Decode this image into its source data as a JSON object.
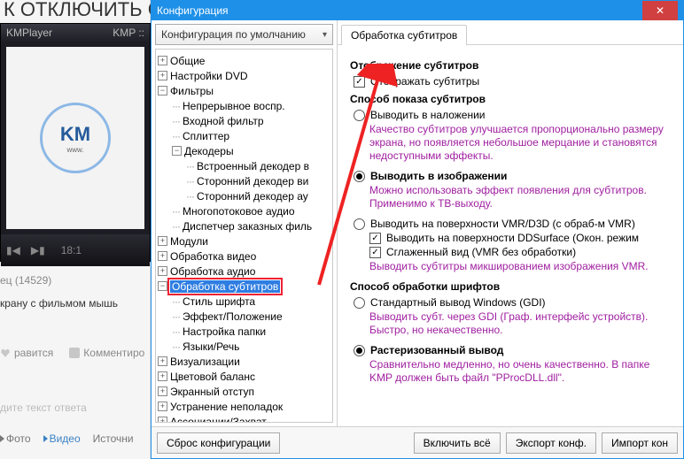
{
  "bg": {
    "title": "К ОТКЛЮЧИТЬ СУ",
    "kmp_title_left": "KMPlayer",
    "kmp_title_right": "KMP ::",
    "kmp_logo_text": "KM",
    "kmp_logo_sub": "www.",
    "kmp_time": "18:1",
    "meta": "ец (14529)",
    "instr": "крану с фильмом мышь",
    "like": "равится",
    "comment": "Комментиро",
    "answer_ph": "дите текст ответа",
    "tab_photo": "Фото",
    "tab_video": "Видео",
    "tab_src": "Источни"
  },
  "cfg": {
    "title": "Конфигурация",
    "combo": "Конфигурация по умолчанию",
    "tree": {
      "general": "Общие",
      "dvd": "Настройки DVD",
      "filters": "Фильтры",
      "f_cont": "Непрерывное воспр.",
      "f_in": "Входной фильтр",
      "f_split": "Сплиттер",
      "decoders": "Декодеры",
      "d_builtin": "Встроенный декодер в",
      "d_extv": "Сторонний декодер ви",
      "d_exta": "Сторонний декодер ау",
      "multi": "Многопотоковое аудио",
      "disp": "Диспетчер заказных филь",
      "modules": "Модули",
      "vproc": "Обработка видео",
      "aproc": "Обработка аудио",
      "sproc": "Обработка субтитров",
      "s_font": "Стиль шрифта",
      "s_eff": "Эффект/Положение",
      "s_folder": "Настройка папки",
      "s_lang": "Языки/Речь",
      "vis": "Визуализации",
      "color": "Цветовой баланс",
      "pan": "Экранный отступ",
      "trouble": "Устранение неполадок",
      "assoc": "Ассоциации/Захват"
    },
    "tab": "Обработка субтитров",
    "grp_display": "Отображение субтитров",
    "chk_show": "Отображать субтитры",
    "grp_method": "Способ показа субтитров",
    "r_overlay": "Выводить в наложении",
    "r_overlay_desc": "Качество субтитров улучшается пропорционально размеру экрана, но появляется небольшое мерцание и становятся недоступными эффекты.",
    "r_image": "Выводить в изображении",
    "r_image_desc": "Можно использовать эффект появления для субтитров. Применимо к ТВ-выходу.",
    "r_vmr": "Выводить на поверхности VMR/D3D (с обраб-м VMR)",
    "c_dd": "Выводить на поверхности DDSurface (Окон. режим",
    "c_smooth": "Сглаженный вид (VMR без обработки)",
    "vmr_desc": "Выводить субтитры микшированием изображения VMR.",
    "grp_font": "Способ обработки шрифтов",
    "r_gdi": "Стандартный вывод Windows (GDI)",
    "r_gdi_desc": "Выводить субт. через GDI (Граф. интерфейс устройств). Быстро, но некачественно.",
    "r_raster": "Растеризованный вывод",
    "r_raster_desc": "Сравнительно медленно, но очень качественно. В папке KMP должен быть файл \"PProcDLL.dll\".",
    "btn_reset": "Сброс конфигурации",
    "btn_incl": "Включить всё",
    "btn_ex": "Экспорт конф.",
    "btn_im": "Импорт кон"
  }
}
